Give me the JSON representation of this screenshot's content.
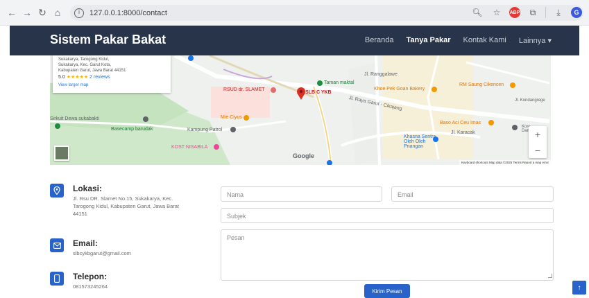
{
  "browser": {
    "url": "127.0.0.1:8000/contact",
    "back_icon": "arrow-left",
    "forward_icon": "arrow-right",
    "reload_icon": "reload",
    "home_icon": "home",
    "ext_label": "ABP",
    "avatar_letter": "G"
  },
  "navbar": {
    "brand": "Sistem Pakar Bakat",
    "menu": [
      "Beranda",
      "Tanya Pakar",
      "Kontak Kami",
      "Lainnya ▾"
    ],
    "active_index": 1
  },
  "map": {
    "card": {
      "address_line1": "Sukakarya, Tarogong Kidul,",
      "address_line2": "Sukakarya, Kec. Garut Kota,",
      "address_line3": "Kabupaten Garut, Jawa Barat 44151",
      "rating": "5.0",
      "stars": "★★★★★",
      "reviews": "2 reviews",
      "view_larger": "View larger map"
    },
    "labels": {
      "rsud": "RSUD dr. SLAMET",
      "slb": "SLB C YKB",
      "taman": "Taman maktal",
      "khoe": "Khoe Pek Goan Bakery",
      "rm": "RM Saung Cikencen",
      "mie": "Mie Ciyus",
      "kampung": "Kampung Patrol",
      "kost": "KOST NISABILA",
      "khasna": "Khasna Sentra Oleh Oleh Priangan",
      "baso": "Baso Aci Ceu Imas",
      "karacak": "Jl. Karacak",
      "sirkuit": "Sirkuit Dewa sukabakti",
      "basecamp": "Basecamp barudak",
      "ranggalawe": "Jl. Ranggalawe",
      "cikajang": "Jl. Raya Garut - Cikajang",
      "kondangrege": "Jl. Kondangrege",
      "google": "Google",
      "kore": "Kore Dam"
    },
    "footer": "Keyboard shortcuts   Map data ©2025   Terms   Report a map error",
    "zoom_in": "+",
    "zoom_out": "−"
  },
  "contact": {
    "lokasi_title": "Lokasi:",
    "lokasi_text": "Jl. Rsu DR. Slamet No.15, Sukakarya, Kec. Tarogong Kidul, Kabupaten Garut, Jawa Barat 44151",
    "email_title": "Email:",
    "email_text": "slbcykbgarut@gmail.com",
    "telepon_title": "Telepon:",
    "telepon_text": "081573245264"
  },
  "form": {
    "nama": "Nama",
    "email": "Email",
    "subjek": "Subjek",
    "pesan": "Pesan",
    "submit": "Kirim Pesan"
  },
  "colors": {
    "navbar": "#28344a",
    "accent": "#2962c9"
  }
}
